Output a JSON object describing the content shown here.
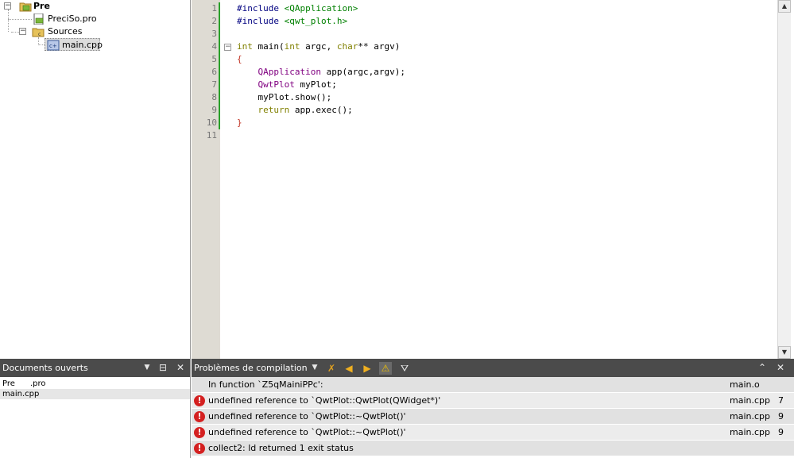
{
  "project_tree": {
    "project_name": "Pre",
    "pro_file": "PreciSo.pro",
    "sources_folder": "Sources",
    "source_file": "main.cpp"
  },
  "editor": {
    "line_numbers": [
      "1",
      "2",
      "3",
      "4",
      "5",
      "6",
      "7",
      "8",
      "9",
      "10",
      "11"
    ],
    "code": [
      [
        {
          "t": "#include ",
          "c": "pp"
        },
        {
          "t": "<QApplication>",
          "c": "inc"
        }
      ],
      [
        {
          "t": "#include ",
          "c": "pp"
        },
        {
          "t": "<qwt_plot.h>",
          "c": "inc"
        }
      ],
      [],
      [
        {
          "t": "int",
          "c": "kw"
        },
        {
          "t": " main(",
          "c": "tx"
        },
        {
          "t": "int",
          "c": "kw"
        },
        {
          "t": " argc, ",
          "c": "tx"
        },
        {
          "t": "char",
          "c": "kw"
        },
        {
          "t": "** argv)",
          "c": "tx"
        }
      ],
      [
        {
          "t": "{",
          "c": "br"
        }
      ],
      [
        {
          "t": "    ",
          "c": "tx"
        },
        {
          "t": "QApplication",
          "c": "ty"
        },
        {
          "t": " app(argc,argv);",
          "c": "tx"
        }
      ],
      [
        {
          "t": "    ",
          "c": "tx"
        },
        {
          "t": "QwtPlot",
          "c": "ty"
        },
        {
          "t": " myPlot;",
          "c": "tx"
        }
      ],
      [
        {
          "t": "    myPlot.show();",
          "c": "tx"
        }
      ],
      [
        {
          "t": "    ",
          "c": "tx"
        },
        {
          "t": "return",
          "c": "kw"
        },
        {
          "t": " app.exec();",
          "c": "tx"
        }
      ],
      [
        {
          "t": "}",
          "c": "br"
        }
      ],
      []
    ]
  },
  "docs_pane": {
    "title": "Documents ouverts",
    "items": [
      {
        "label": "Pre      .pro"
      },
      {
        "label": "main.cpp"
      }
    ]
  },
  "issues_pane": {
    "title": "Problèmes de compilation",
    "rows": [
      {
        "text": "In function `Z5qMainiPPc':",
        "file": "main.o",
        "line": "",
        "error": false
      },
      {
        "text": "undefined reference to `QwtPlot::QwtPlot(QWidget*)'",
        "file": "main.cpp",
        "line": "7",
        "error": true
      },
      {
        "text": "undefined reference to `QwtPlot::~QwtPlot()'",
        "file": "main.cpp",
        "line": "9",
        "error": true
      },
      {
        "text": "undefined reference to `QwtPlot::~QwtPlot()'",
        "file": "main.cpp",
        "line": "9",
        "error": true
      },
      {
        "text": "collect2: ld returned 1 exit status",
        "file": "",
        "line": "",
        "error": true
      }
    ]
  },
  "colors": {
    "pane_header": "#4b4b4b",
    "error": "#d42020",
    "keyword": "#808000",
    "type": "#800080",
    "include": "#008000",
    "preprocessor": "#000080",
    "modified_bar": "#2aa02a"
  },
  "icons": {
    "tree_toggle": "tree-collapse-icon",
    "error": "error-icon",
    "warning": "warning-filter-icon"
  }
}
